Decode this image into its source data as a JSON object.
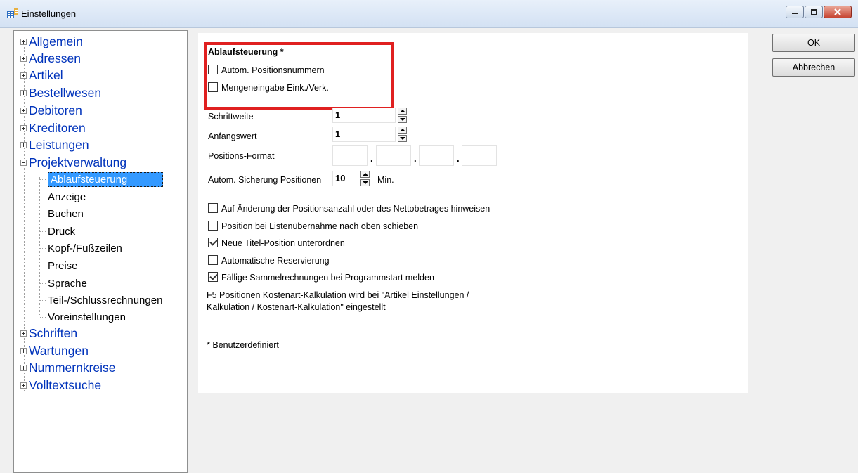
{
  "window": {
    "title": "Einstellungen"
  },
  "tree": {
    "top_before": [
      "Allgemein",
      "Adressen",
      "Artikel",
      "Bestellwesen",
      "Debitoren",
      "Kreditoren",
      "Leistungen"
    ],
    "expanded": "Projektverwaltung",
    "children": [
      "Ablaufsteuerung",
      "Anzeige",
      "Buchen",
      "Druck",
      "Kopf-/Fußzeilen",
      "Preise",
      "Sprache",
      "Teil-/Schlussrechnungen",
      "Voreinstellungen"
    ],
    "selected_child": "Ablaufsteuerung",
    "top_after": [
      "Schriften",
      "Wartungen",
      "Nummernkreise",
      "Volltextsuche"
    ]
  },
  "panel": {
    "heading": "Ablaufsteuerung *",
    "cb_auto_pos": {
      "label": "Autom. Positionsnummern",
      "checked": false
    },
    "cb_menge": {
      "label": "Mengeneingabe Eink./Verk.",
      "checked": false
    },
    "schrittweite": {
      "label": "Schrittweite",
      "value": "1"
    },
    "anfangswert": {
      "label": "Anfangswert",
      "value": "1"
    },
    "positions_format": {
      "label": "Positions-Format",
      "separator": "."
    },
    "sicherung": {
      "label": "Autom. Sicherung Positionen",
      "value": "10",
      "unit": "Min."
    },
    "options": [
      {
        "label": "Auf Änderung der Positionsanzahl oder des Nettobetrages hinweisen",
        "checked": false
      },
      {
        "label": "Position bei Listenübernahme nach oben schieben",
        "checked": false
      },
      {
        "label": "Neue Titel-Position unterordnen",
        "checked": true
      },
      {
        "label": "Automatische Reservierung",
        "checked": false
      },
      {
        "label": "Fällige Sammelrechnungen bei Programmstart melden",
        "checked": true
      }
    ],
    "info_line1": "F5 Positionen Kostenart-Kalkulation wird bei \"Artikel Einstellungen /",
    "info_line2": "Kalkulation / Kostenart-Kalkulation\" eingestellt",
    "footnote": "* Benutzerdefiniert"
  },
  "buttons": {
    "ok": "OK",
    "cancel": "Abbrechen"
  }
}
